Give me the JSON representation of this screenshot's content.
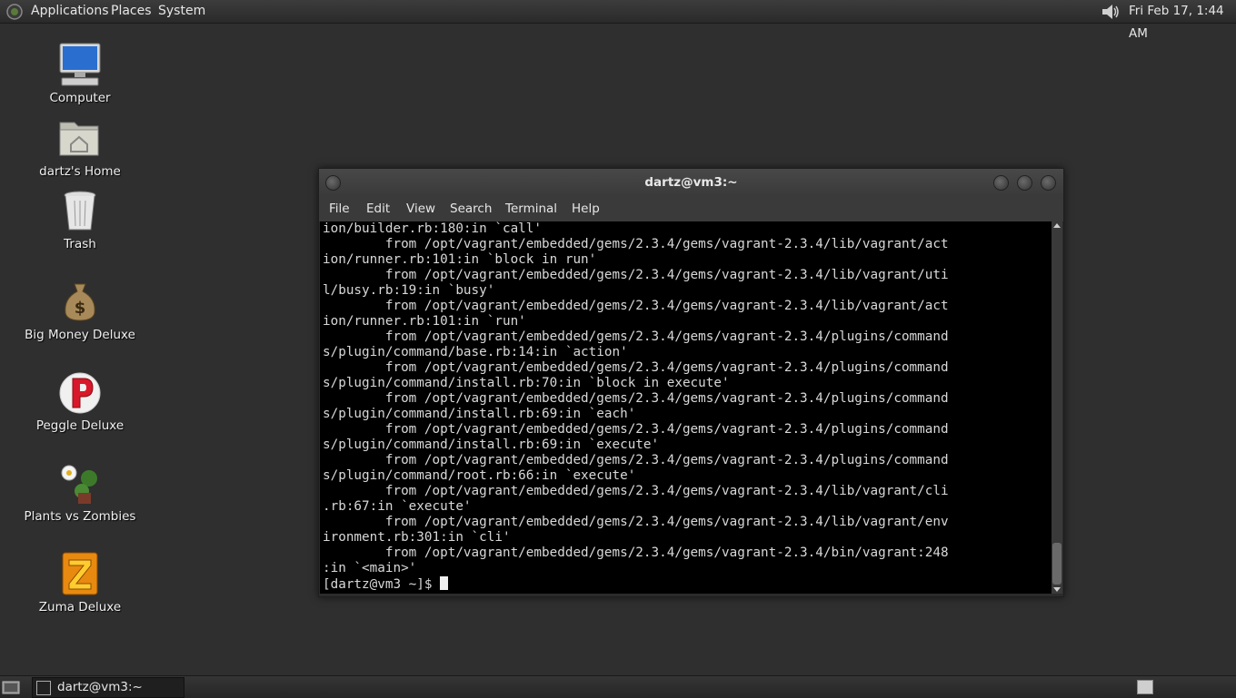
{
  "top_panel": {
    "menus": {
      "applications": "Applications",
      "places": "Places",
      "system": "System"
    },
    "clock": "Fri Feb 17,  1:44 AM"
  },
  "desktop": {
    "icons": [
      {
        "label": "Computer",
        "icon": "computer-icon"
      },
      {
        "label": "dartz's Home",
        "icon": "home-folder-icon"
      },
      {
        "label": "Trash",
        "icon": "trash-icon"
      },
      {
        "label": "Big Money Deluxe",
        "icon": "money-bag-icon"
      },
      {
        "label": "Peggle Deluxe",
        "icon": "peggle-icon"
      },
      {
        "label": "Plants vs Zombies",
        "icon": "plants-vs-zombies-icon"
      },
      {
        "label": "Zuma Deluxe",
        "icon": "zuma-icon"
      }
    ]
  },
  "terminal": {
    "title": "dartz@vm3:~",
    "menus": {
      "file": "File",
      "edit": "Edit",
      "view": "View",
      "search": "Search",
      "terminal": "Terminal",
      "help": "Help"
    },
    "output": "ion/builder.rb:180:in `call'\n        from /opt/vagrant/embedded/gems/2.3.4/gems/vagrant-2.3.4/lib/vagrant/act\nion/runner.rb:101:in `block in run'\n        from /opt/vagrant/embedded/gems/2.3.4/gems/vagrant-2.3.4/lib/vagrant/uti\nl/busy.rb:19:in `busy'\n        from /opt/vagrant/embedded/gems/2.3.4/gems/vagrant-2.3.4/lib/vagrant/act\nion/runner.rb:101:in `run'\n        from /opt/vagrant/embedded/gems/2.3.4/gems/vagrant-2.3.4/plugins/command\ns/plugin/command/base.rb:14:in `action'\n        from /opt/vagrant/embedded/gems/2.3.4/gems/vagrant-2.3.4/plugins/command\ns/plugin/command/install.rb:70:in `block in execute'\n        from /opt/vagrant/embedded/gems/2.3.4/gems/vagrant-2.3.4/plugins/command\ns/plugin/command/install.rb:69:in `each'\n        from /opt/vagrant/embedded/gems/2.3.4/gems/vagrant-2.3.4/plugins/command\ns/plugin/command/install.rb:69:in `execute'\n        from /opt/vagrant/embedded/gems/2.3.4/gems/vagrant-2.3.4/plugins/command\ns/plugin/command/root.rb:66:in `execute'\n        from /opt/vagrant/embedded/gems/2.3.4/gems/vagrant-2.3.4/lib/vagrant/cli\n.rb:67:in `execute'\n        from /opt/vagrant/embedded/gems/2.3.4/gems/vagrant-2.3.4/lib/vagrant/env\nironment.rb:301:in `cli'\n        from /opt/vagrant/embedded/gems/2.3.4/gems/vagrant-2.3.4/bin/vagrant:248\n:in `<main>'",
    "prompt": "[dartz@vm3 ~]$ "
  },
  "taskbar": {
    "window_label": "dartz@vm3:~"
  }
}
